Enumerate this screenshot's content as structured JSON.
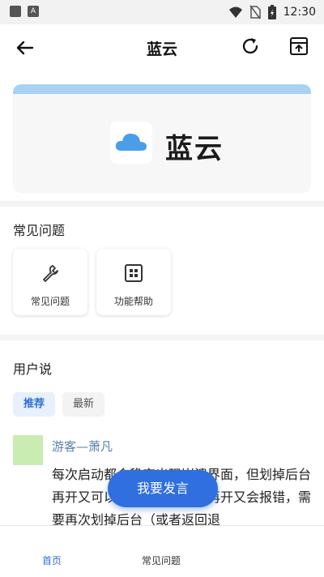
{
  "status_bar": {
    "time": "12:30",
    "notification_letter": "A",
    "icons": [
      "square-icon",
      "a-icon",
      "wifi-icon",
      "no-sim-icon",
      "battery-charging-icon"
    ]
  },
  "app_bar": {
    "title": "蓝云",
    "icons": [
      "back-arrow-icon",
      "refresh-icon",
      "browser-icon"
    ]
  },
  "banner": {
    "logo_text": "蓝云",
    "accent_color": "#a9d1f5",
    "cloud_color": "#4a9ee8"
  },
  "faq": {
    "title": "常见问题",
    "tiles": [
      {
        "label": "常见问题",
        "icon": "wrench-icon"
      },
      {
        "label": "功能帮助",
        "icon": "grid-icon"
      }
    ]
  },
  "users": {
    "title": "用户说",
    "tabs": [
      {
        "label": "推荐",
        "active": true
      },
      {
        "label": "最新",
        "active": false
      }
    ],
    "post": {
      "username": "游客—萧凡",
      "text": "每次启动都会稳定出现崩溃界面，但划掉后台再开又可以用，过一段时间再开又会报错，需要再次划掉后台（或者返回退"
    }
  },
  "fab": {
    "label": "我要发言",
    "color": "#2f6fe0"
  },
  "bottom_nav": [
    {
      "label": "首页",
      "active": true
    },
    {
      "label": "常见问题",
      "active": false
    }
  ]
}
